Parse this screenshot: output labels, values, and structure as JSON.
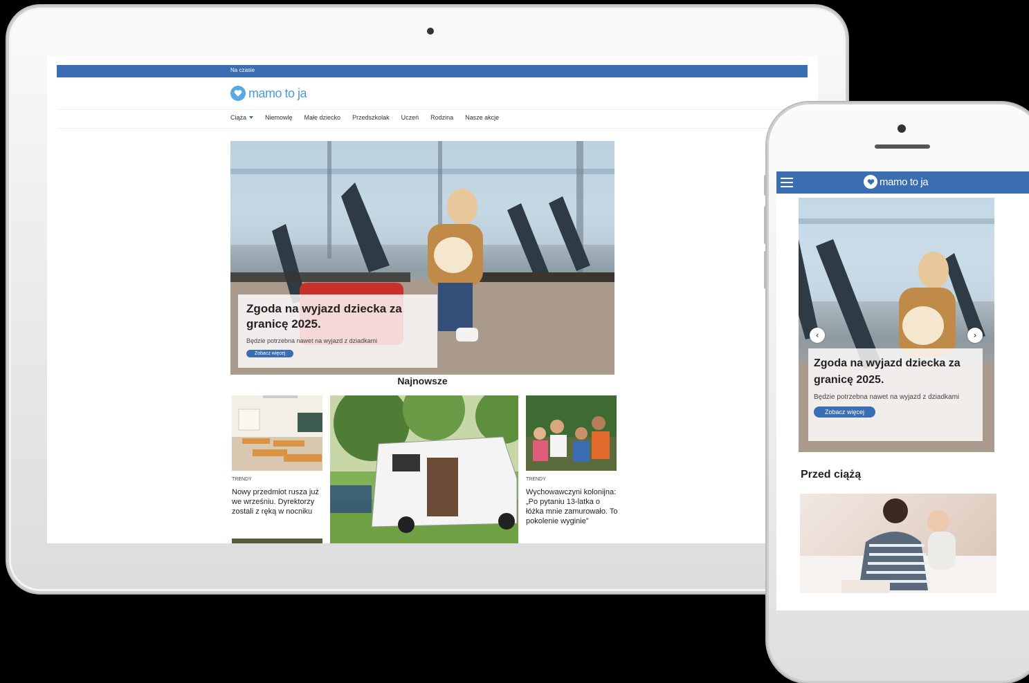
{
  "tablet": {
    "topbar_label": "Na czasie",
    "logo_text": "mamo to ja",
    "nav": [
      {
        "label": "Ciąża",
        "has_dropdown": true
      },
      {
        "label": "Niemowlę"
      },
      {
        "label": "Małe dziecko"
      },
      {
        "label": "Przedszkolak"
      },
      {
        "label": "Uczeń"
      },
      {
        "label": "Rodzina"
      },
      {
        "label": "Nasze akcje"
      }
    ],
    "hero": {
      "title": "Zgoda na wyjazd dziecka za granicę 2025.",
      "subtitle": "Będzie potrzebna nawet na wyjazd z dziadkami",
      "button": "Zobacz więcej"
    },
    "section_title": "Najnowsze",
    "cards": [
      {
        "tag": "TRENDY",
        "title": "Nowy przedmiot rusza już we wrześniu. Dyrektorzy zostali z ręką w nocniku"
      },
      {
        "tag": "",
        "title": ""
      },
      {
        "tag": "TRENDY",
        "title": "Wychowawczyni kolonijna: „Po pytaniu 13-latka o łóżka mnie zamurowało. To pokolenie wyginie”"
      }
    ]
  },
  "phone": {
    "logo_text": "mamo to ja",
    "hero": {
      "title": "Zgoda na wyjazd dziecka za granicę 2025.",
      "subtitle": "Będzie potrzebna nawet na wyjazd z dziadkami",
      "button": "Zobacz więcej"
    },
    "section_title": "Przed ciążą"
  },
  "colors": {
    "brand_blue": "#3b6db2",
    "logo_blue": "#4b9ad3"
  }
}
